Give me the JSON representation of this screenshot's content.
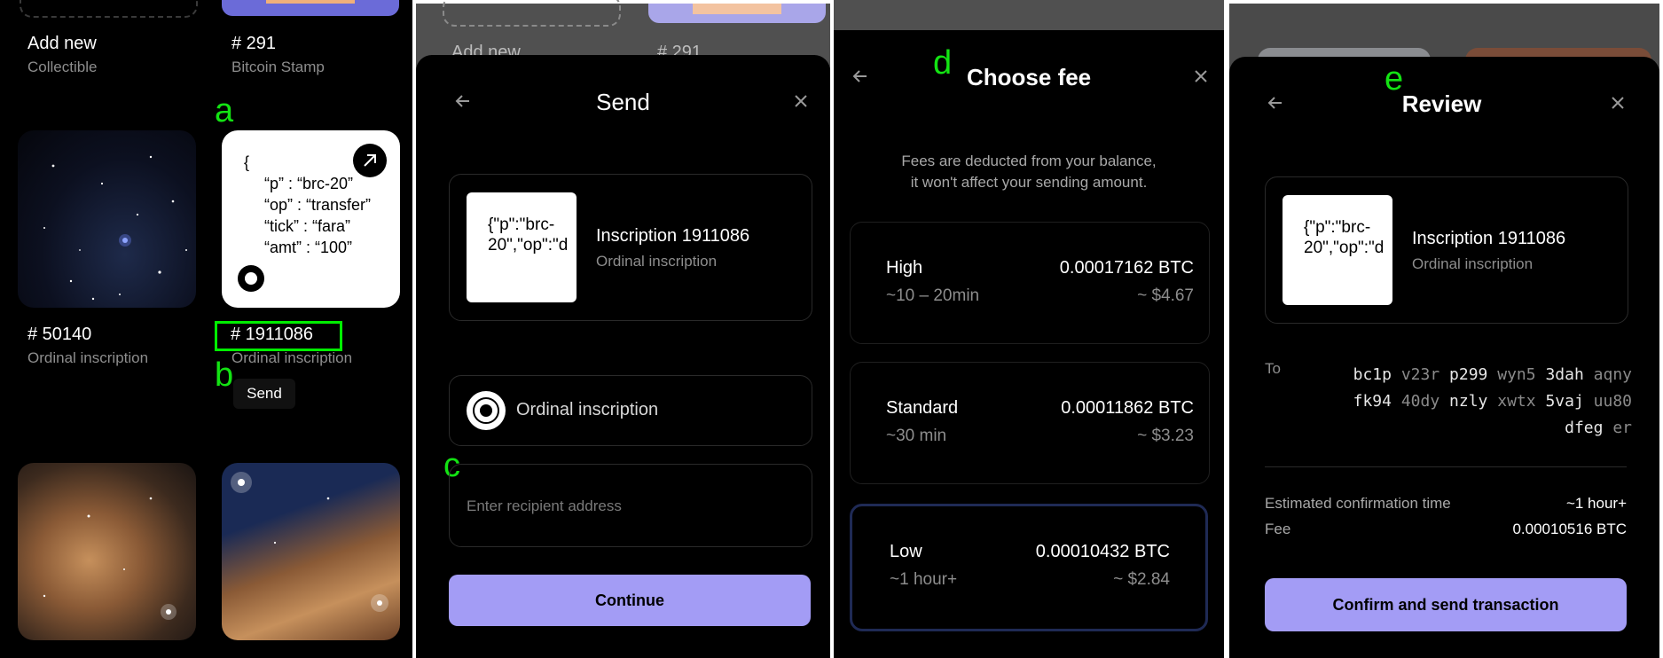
{
  "grid": {
    "add_new_title": "Add new",
    "add_new_sub": "Collectible",
    "stamp_title": "# 291",
    "stamp_sub": "Bitcoin Stamp",
    "item1_title": "# 50140",
    "item1_sub": "Ordinal inscription",
    "item2_title": "# 1911086",
    "item2_sub": "Ordinal inscription",
    "send_label": "Send",
    "brc20": {
      "open": "{",
      "line_p": "“p” : “brc-20”",
      "line_op": "“op” : “transfer”",
      "line_tick": "“tick” : “fara”",
      "line_amt": "“amt” : “100”"
    }
  },
  "annotations": {
    "a": "a",
    "b": "b",
    "c": "c",
    "d": "d",
    "e": "e"
  },
  "send": {
    "bg_add_new": "Add new",
    "bg_stamp": "# 291",
    "title": "Send",
    "thumb_text_1": "{\"p\":\"brc-",
    "thumb_text_2": "20\",\"op\":\"d",
    "inscription_title": "Inscription 1911086",
    "inscription_sub": "Ordinal inscription",
    "type_label": "Ordinal inscription",
    "recipient_placeholder": "Enter recipient address",
    "continue_label": "Continue"
  },
  "fee": {
    "title": "Choose fee",
    "note_1": "Fees are deducted from your balance,",
    "note_2": "it won't affect your sending amount.",
    "options": [
      {
        "name": "High",
        "time": "~10 – 20min",
        "btc": "0.00017162 BTC",
        "usd": "~ $4.67"
      },
      {
        "name": "Standard",
        "time": "~30 min",
        "btc": "0.00011862 BTC",
        "usd": "~ $3.23"
      },
      {
        "name": "Low",
        "time": "~1 hour+",
        "btc": "0.00010432 BTC",
        "usd": "~ $2.84"
      }
    ],
    "selected": "Low"
  },
  "review": {
    "title": "Review",
    "thumb_text_1": "{\"p\":\"brc-",
    "thumb_text_2": "20\",\"op\":\"d",
    "inscription_title": "Inscription 1911086",
    "inscription_sub": "Ordinal inscription",
    "to_label": "To",
    "address_rows": [
      [
        "bc1p",
        "v23r",
        "p299",
        "wyn5",
        "3dah",
        "aqny"
      ],
      [
        "fk94",
        "40dy",
        "nzly",
        "xwtx",
        "5vaj",
        "uu80"
      ],
      [
        "dfeg",
        "er"
      ]
    ],
    "est_time_label": "Estimated confirmation time",
    "est_time_value": "~1 hour+",
    "fee_label": "Fee",
    "fee_value": "0.00010516 BTC",
    "confirm_label": "Confirm and send transaction"
  },
  "colors": {
    "accent": "#a39cf5",
    "annotation": "#13e313",
    "highlight": "#00ee00",
    "selected_border": "#1f2a55"
  }
}
